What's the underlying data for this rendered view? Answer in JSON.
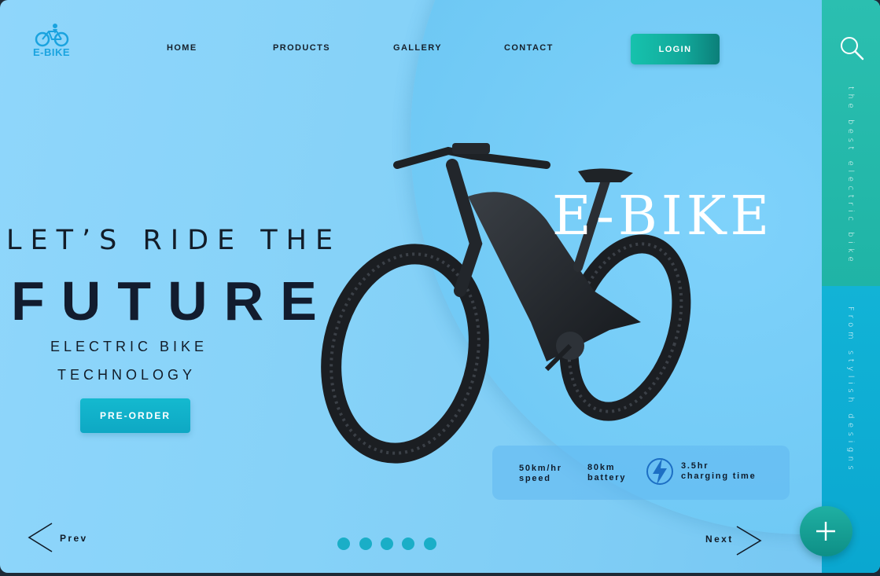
{
  "brand": {
    "logo_text": "E-BIKE"
  },
  "nav": {
    "items": [
      {
        "label": "HOME"
      },
      {
        "label": "PRODUCTS"
      },
      {
        "label": "GALLERY"
      },
      {
        "label": "CONTACT"
      }
    ],
    "login_label": "LOGIN"
  },
  "hero": {
    "line1": "LET’S RIDE THE",
    "line2": "FUTURE",
    "sub1": "ELECTRIC BIKE",
    "sub2": "TECHNOLOGY",
    "cta_label": "PRE-ORDER",
    "product_title": "E-BIKE"
  },
  "specs": {
    "speed_value": "50km/hr",
    "speed_label": "speed",
    "battery_value": "80km",
    "battery_label": "battery",
    "charge_value": "3.5hr",
    "charge_label": "charging time",
    "bolt_icon": "lightning-bolt-icon"
  },
  "rail": {
    "tagline_top": "the best electric bike",
    "tagline_bottom": "From stylish designs"
  },
  "carousel": {
    "prev_label": "Prev",
    "next_label": "Next",
    "dot_count": 5
  },
  "colors": {
    "accent_teal": "#16c2ad",
    "accent_cyan": "#0ea8c4",
    "background": "#8fd6fb"
  }
}
